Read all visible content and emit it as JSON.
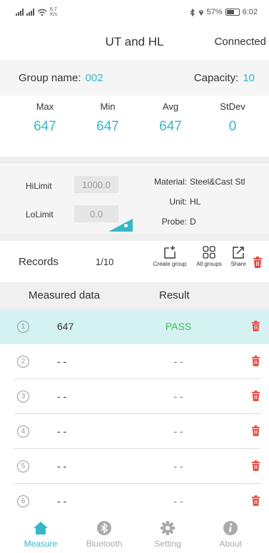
{
  "status_bar": {
    "net_speed_value": "6.7",
    "net_speed_unit": "K/s",
    "battery": "57%",
    "time": "6:02"
  },
  "header": {
    "title": "UT and HL",
    "connection": "Connected"
  },
  "group": {
    "name_label": "Group name:",
    "name_value": "002",
    "capacity_label": "Capacity:",
    "capacity_value": "10"
  },
  "stats": [
    {
      "label": "Max",
      "value": "647"
    },
    {
      "label": "Min",
      "value": "647"
    },
    {
      "label": "Avg",
      "value": "647"
    },
    {
      "label": "StDev",
      "value": "0"
    }
  ],
  "limits": {
    "hi_label": "HiLimit",
    "hi_value": "1000.0",
    "lo_label": "LoLimit",
    "lo_value": "0.0"
  },
  "info": {
    "material_label": "Material:",
    "material_value": "Steel&Cast Stl",
    "unit_label": "Unit:",
    "unit_value": "HL",
    "probe_label": "Probe:",
    "probe_value": "D"
  },
  "records": {
    "label": "Records",
    "count": "1/10",
    "create_group": "Create group",
    "all_groups": "All groups",
    "share": "Share"
  },
  "table": {
    "col_measured": "Measured data",
    "col_result": "Result",
    "rows": [
      {
        "index": "1",
        "value": "647",
        "result": "PASS"
      },
      {
        "index": "2",
        "value": "- -",
        "result": "- -"
      },
      {
        "index": "3",
        "value": "- -",
        "result": "- -"
      },
      {
        "index": "4",
        "value": "- -",
        "result": "- -"
      },
      {
        "index": "5",
        "value": "- -",
        "result": "- -"
      },
      {
        "index": "6",
        "value": "- -",
        "result": "- -"
      }
    ]
  },
  "tabs": [
    {
      "label": "Measure",
      "icon": "home-icon",
      "active": true
    },
    {
      "label": "Bluetooth",
      "icon": "bluetooth-icon",
      "active": false
    },
    {
      "label": "Setting",
      "icon": "gear-icon",
      "active": false
    },
    {
      "label": "About",
      "icon": "info-icon",
      "active": false
    }
  ],
  "colors": {
    "accent": "#35b8c8",
    "pass": "#3dbb56",
    "delete": "#e8453c",
    "active_row": "#d5f2f3"
  }
}
